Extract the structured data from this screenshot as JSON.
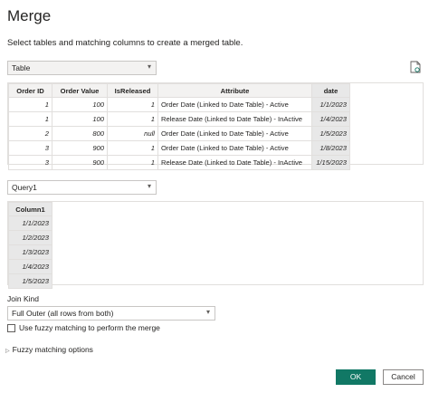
{
  "dialog": {
    "title": "Merge",
    "subtitle": "Select tables and matching columns to create a merged table."
  },
  "table1": {
    "selected": "Table",
    "columns": [
      "Order ID",
      "Order Value",
      "IsReleased",
      "Attribute",
      "date"
    ],
    "rows": [
      [
        "1",
        "100",
        "1",
        "Order Date (Linked to Date Table) - Active",
        "1/1/2023"
      ],
      [
        "1",
        "100",
        "1",
        "Release Date (Linked to Date Table) - InActive",
        "1/4/2023"
      ],
      [
        "2",
        "800",
        "null",
        "Order Date (Linked to Date Table) - Active",
        "1/5/2023"
      ],
      [
        "3",
        "900",
        "1",
        "Order Date (Linked to Date Table) - Active",
        "1/8/2023"
      ],
      [
        "3",
        "900",
        "1",
        "Release Date (Linked to Date Table) - InActive",
        "1/15/2023"
      ]
    ]
  },
  "table2": {
    "selected": "Query1",
    "columns": [
      "Column1"
    ],
    "rows": [
      [
        "1/1/2023"
      ],
      [
        "1/2/2023"
      ],
      [
        "1/3/2023"
      ],
      [
        "1/4/2023"
      ],
      [
        "1/5/2023"
      ]
    ]
  },
  "join": {
    "label": "Join Kind",
    "selected": "Full Outer (all rows from both)",
    "fuzzy_checkbox_label": "Use fuzzy matching to perform the merge",
    "fuzzy_checked": false,
    "fuzzy_options_label": "Fuzzy matching options"
  },
  "buttons": {
    "ok": "OK",
    "cancel": "Cancel"
  },
  "colors": {
    "ok_button": "#117865",
    "selected_column": "#e8e8e8"
  }
}
